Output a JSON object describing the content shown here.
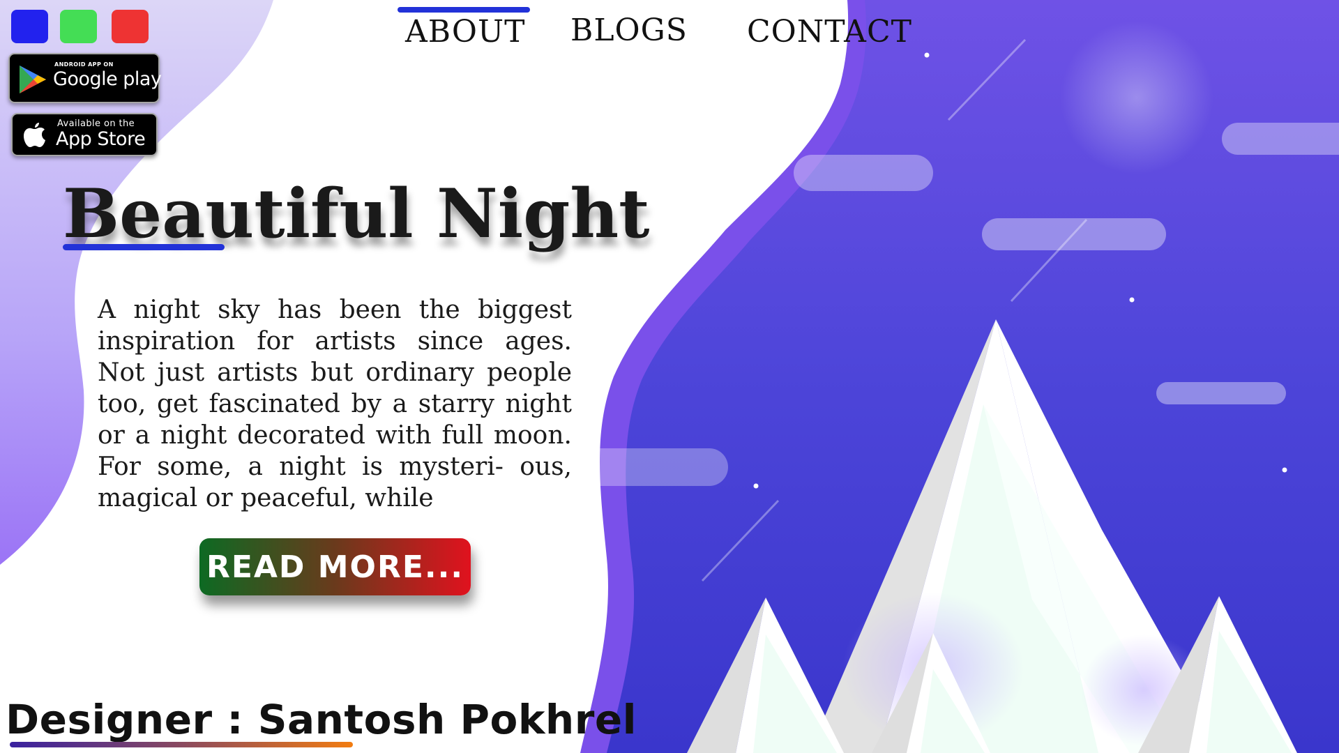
{
  "theme_switcher": {
    "colors": [
      "#2222ee",
      "#44dd55",
      "#ee3333"
    ]
  },
  "store_badges": {
    "google_play": {
      "small": "ANDROID APP ON",
      "big": "Google play"
    },
    "app_store": {
      "small": "Available on the",
      "big": "App Store"
    }
  },
  "nav": {
    "items": [
      {
        "label": "ABOUT",
        "active": true
      },
      {
        "label": "BLOGS",
        "active": false
      },
      {
        "label": "CONTACT",
        "active": false
      }
    ],
    "accent": "#2232d8"
  },
  "hero": {
    "title": "Beautiful Night",
    "body": "A night sky has been the biggest inspiration for artists since ages. Not just artists but ordinary people too, get fascinated by a starry night or a night decorated with full moon. For some, a night is mysteri- ous, magical or peaceful, while",
    "button": "READ MORE..."
  },
  "footer": {
    "designer": "Designer : Santosh Pokhrel"
  },
  "illustration": {
    "background_colors": [
      "#7b4fe8",
      "#4a3fd6",
      "#3530c8"
    ],
    "moon_color": "#ffffff",
    "mountain_colors": [
      "#ffffff",
      "#dcdcdc",
      "#effdf6"
    ]
  }
}
